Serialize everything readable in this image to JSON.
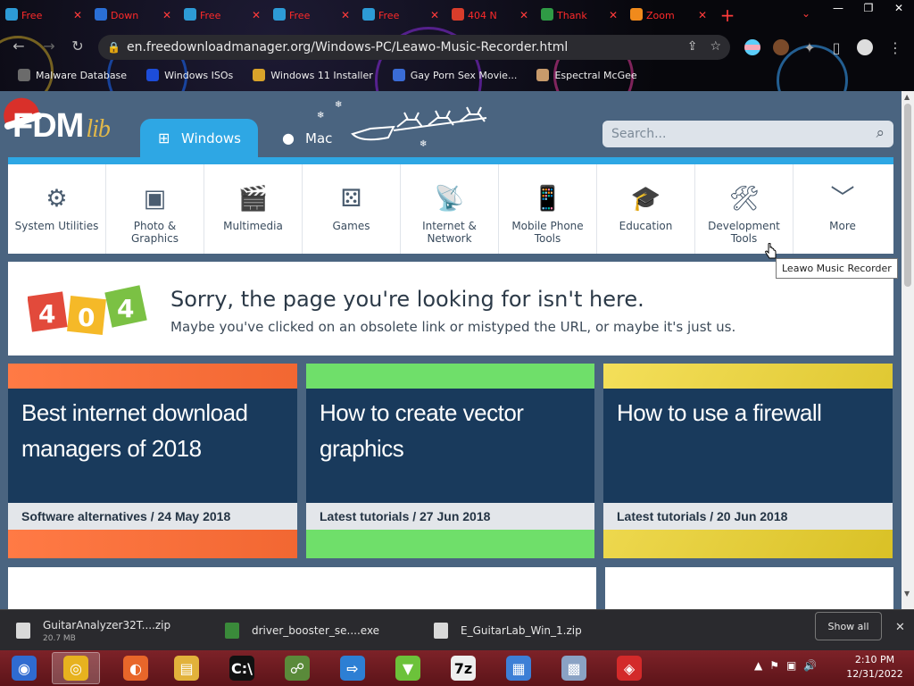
{
  "browser": {
    "tabs": [
      {
        "title": "Free",
        "color": "#2d9bd6"
      },
      {
        "title": "Down",
        "color": "#2a6fd6"
      },
      {
        "title": "Free",
        "color": "#2d9bd6"
      },
      {
        "title": "Free",
        "color": "#2d9bd6"
      },
      {
        "title": "Free",
        "color": "#2d9bd6"
      },
      {
        "title": "404 N",
        "color": "#d93d2b"
      },
      {
        "title": "Thank",
        "color": "#2f9a45"
      },
      {
        "title": "Zoom",
        "color": "#f08a1c"
      }
    ],
    "new_tab": "+",
    "url": "en.freedownloadmanager.org/Windows-PC/Leawo-Music-Recorder.html",
    "bookmarks": [
      {
        "label": "Malware Database",
        "icon": "malware-icon",
        "color": "#6b6b6b"
      },
      {
        "label": "Windows ISOs",
        "icon": "x-icon",
        "color": "#1d4dd9"
      },
      {
        "label": "Windows 11 Installer",
        "icon": "windows-installer-icon",
        "color": "#d9a32a"
      },
      {
        "label": "Gay Porn Sex Movie...",
        "icon": "site-icon",
        "color": "#3a6cd6"
      },
      {
        "label": "Espectral McGee",
        "icon": "avatar-icon",
        "color": "#c79a6b"
      }
    ]
  },
  "site": {
    "logo_main": "FDM",
    "logo_lib": "lib",
    "os_tabs": [
      {
        "label": "Windows",
        "icon": "windows-icon"
      },
      {
        "label": "Mac",
        "icon": "apple-icon"
      }
    ],
    "search_placeholder": "Search...",
    "categories": [
      {
        "label": "System Utilities",
        "icon": "gears-icon",
        "glyph": "⚙"
      },
      {
        "label": "Photo &\nGraphics",
        "icon": "photo-icon",
        "glyph": "▣"
      },
      {
        "label": "Multimedia",
        "icon": "clapperboard-icon",
        "glyph": "🎬"
      },
      {
        "label": "Games",
        "icon": "dice-icon",
        "glyph": "⚄"
      },
      {
        "label": "Internet &\nNetwork",
        "icon": "router-icon",
        "glyph": "📡"
      },
      {
        "label": "Mobile Phone\nTools",
        "icon": "mobile-globe-icon",
        "glyph": "📱"
      },
      {
        "label": "Education",
        "icon": "graduation-cap-icon",
        "glyph": "🎓"
      },
      {
        "label": "Development\nTools",
        "icon": "wrench-screwdriver-icon",
        "glyph": "🛠"
      },
      {
        "label": "More",
        "icon": "chevron-down-icon",
        "glyph": "﹀"
      }
    ],
    "tooltip": "Leawo Music Recorder",
    "error": {
      "code_digits": [
        "4",
        "0",
        "4"
      ],
      "title": "Sorry, the page you're looking for isn't here.",
      "message": "Maybe you've clicked on an obsolete link or mistyped the URL, or maybe it's just us."
    },
    "cards": [
      {
        "title": "Best internet download managers of 2018",
        "meta": "Software alternatives / 24 May 2018"
      },
      {
        "title": "How to create vector graphics",
        "meta": "Latest tutorials / 27 Jun 2018"
      },
      {
        "title": "How to use a firewall",
        "meta": "Latest tutorials / 20 Jun 2018"
      }
    ]
  },
  "downloads": {
    "items": [
      {
        "name": "GuitarAnalyzer32T....zip",
        "size": "20.7 MB"
      },
      {
        "name": "driver_booster_se....exe",
        "size": ""
      },
      {
        "name": "E_GuitarLab_Win_1.zip",
        "size": ""
      }
    ],
    "show_all": "Show all"
  },
  "taskbar": {
    "apps": [
      {
        "name": "start-button",
        "color": "#2f6bd0",
        "glyph": "◉"
      },
      {
        "name": "chrome",
        "color": "#e7b21f",
        "glyph": "◎"
      },
      {
        "name": "firefox",
        "color": "#e8662a",
        "glyph": "◐"
      },
      {
        "name": "file-explorer",
        "color": "#e2b23b",
        "glyph": "▤"
      },
      {
        "name": "cmd",
        "color": "#111111",
        "glyph": "C:\\"
      },
      {
        "name": "network-users",
        "color": "#5a8a3a",
        "glyph": "☍"
      },
      {
        "name": "remote-app",
        "color": "#2d7fd4",
        "glyph": "⇨"
      },
      {
        "name": "download-arrow",
        "color": "#6cc23a",
        "glyph": "▼"
      },
      {
        "name": "7zip",
        "color": "#eeeeee",
        "glyph": "7z"
      },
      {
        "name": "iobit",
        "color": "#3d7fd6",
        "glyph": "▦"
      },
      {
        "name": "installer",
        "color": "#8aa2c4",
        "glyph": "▩"
      },
      {
        "name": "media-record",
        "color": "#d32a2a",
        "glyph": "◈"
      }
    ],
    "time": "2:10 PM",
    "date": "12/31/2022"
  }
}
